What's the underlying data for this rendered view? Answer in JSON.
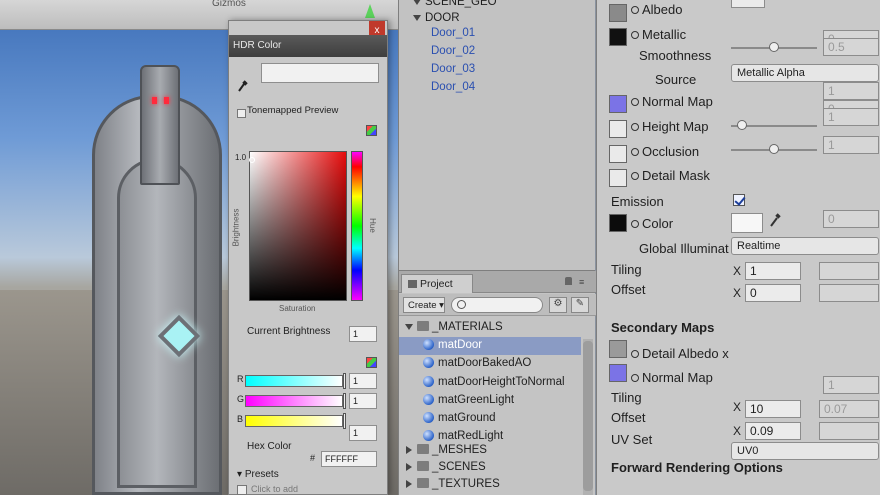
{
  "scene": {
    "tab_label": "Gizmos"
  },
  "hdr_window": {
    "title": "HDR Color",
    "close_glyph": "x",
    "tonemapped_label": "Tonemapped Preview",
    "max_label": "1.0",
    "brightness_label": "Brightness",
    "hue_label": "Hue",
    "saturation_label": "Saturation",
    "current_brightness_label": "Current Brightness",
    "current_brightness_value": "1",
    "channels": [
      {
        "label": "R",
        "value": "1"
      },
      {
        "label": "G",
        "value": "1"
      },
      {
        "label": "B",
        "value": "1"
      }
    ],
    "hex_label": "Hex Color",
    "hex_prefix": "#",
    "hex_value": "FFFFFF",
    "presets_label": "Presets",
    "presets_sub": "Click to add"
  },
  "hierarchy": {
    "items": [
      {
        "label": "SCENE_GEO"
      },
      {
        "label": "DOOR"
      },
      {
        "label": "Door_01"
      },
      {
        "label": "Door_02"
      },
      {
        "label": "Door_03"
      },
      {
        "label": "Door_04"
      }
    ]
  },
  "project": {
    "tab_label": "Project",
    "create_label": "Create",
    "items": [
      {
        "label": "_MATERIALS"
      },
      {
        "label": "matDoor"
      },
      {
        "label": "matDoorBakedAO"
      },
      {
        "label": "matDoorHeightToNormal"
      },
      {
        "label": "matGreenLight"
      },
      {
        "label": "matGround"
      },
      {
        "label": "matRedLight"
      },
      {
        "label": "_MESHES"
      },
      {
        "label": "_SCENES"
      },
      {
        "label": "_TEXTURES"
      }
    ]
  },
  "inspector": {
    "albedo": "Albedo",
    "metallic": "Metallic",
    "smoothness": "Smoothness",
    "source": "Source",
    "source_value": "Metallic Alpha",
    "normal_map": "Normal Map",
    "height_map": "Height Map",
    "occlusion": "Occlusion",
    "detail_mask": "Detail Mask",
    "emission": "Emission",
    "color": "Color",
    "global_illumination": "Global Illuminat",
    "gi_value": "Realtime",
    "tiling": "Tiling",
    "offset": "Offset",
    "x_label": "X",
    "tiling_x": "1",
    "offset_x": "0",
    "secondary_maps": "Secondary Maps",
    "detail_albedo": "Detail Albedo x",
    "normal_map_2": "Normal Map",
    "tiling2": "Tiling",
    "offset2": "Offset",
    "tiling2_x": "10",
    "offset2_x": "0.09",
    "uv_set": "UV Set",
    "uv_value": "UV0",
    "forward_rendering": "Forward Rendering Options",
    "dim_values": [
      "0",
      "0.5",
      "1",
      "0",
      "1",
      "1",
      "0",
      "1",
      "0.07"
    ],
    "colors": {
      "albedo_swatch": "#8a8a8a",
      "metallic_swatch": "#111111",
      "normal_swatch": "#7b73e6",
      "emission_swatch": "#0c0c0c"
    }
  }
}
